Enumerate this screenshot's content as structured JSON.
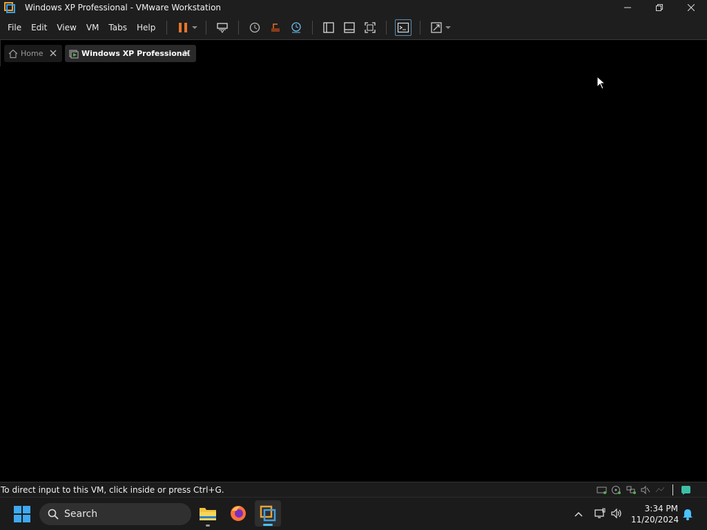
{
  "window": {
    "title": "Windows XP Professional - VMware Workstation"
  },
  "menu": {
    "items": [
      "File",
      "Edit",
      "View",
      "VM",
      "Tabs",
      "Help"
    ]
  },
  "tabs": [
    {
      "label": "Home"
    },
    {
      "label": "Windows XP Professional"
    }
  ],
  "status": {
    "message": "To direct input to this VM, click inside or press Ctrl+G."
  },
  "taskbar": {
    "search_label": "Search",
    "time": "3:34 PM",
    "date": "11/20/2024"
  },
  "colors": {
    "accent": "#4cc2ff",
    "pause": "#e8742b",
    "vmware_blue": "#1f8fd6"
  }
}
